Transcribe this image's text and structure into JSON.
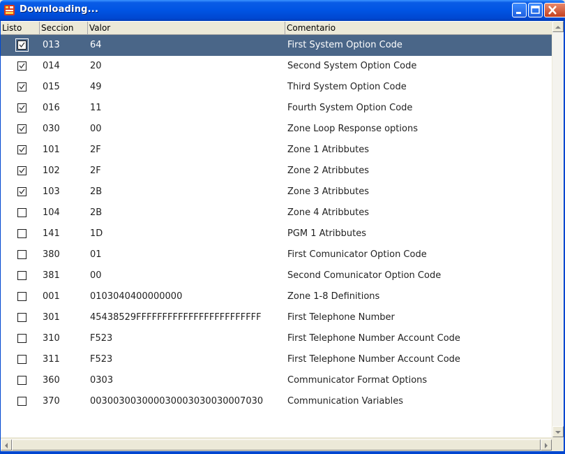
{
  "window": {
    "title": "Downloading...",
    "icon": "app-icon",
    "controls": [
      "minimize-icon",
      "maximize-icon",
      "close-icon"
    ]
  },
  "table": {
    "columns": [
      "Listo",
      "Seccion",
      "Valor",
      "Comentario"
    ],
    "rows": [
      {
        "checked": true,
        "seccion": "013",
        "valor": "64",
        "comentario": "First System Option Code",
        "selected": true
      },
      {
        "checked": true,
        "seccion": "014",
        "valor": "20",
        "comentario": "Second System Option Code"
      },
      {
        "checked": true,
        "seccion": "015",
        "valor": "49",
        "comentario": "Third System Option Code"
      },
      {
        "checked": true,
        "seccion": "016",
        "valor": "11",
        "comentario": "Fourth System Option Code"
      },
      {
        "checked": true,
        "seccion": "030",
        "valor": "00",
        "comentario": "Zone Loop Response options"
      },
      {
        "checked": true,
        "seccion": "101",
        "valor": "2F",
        "comentario": "Zone 1 Atribbutes"
      },
      {
        "checked": true,
        "seccion": "102",
        "valor": "2F",
        "comentario": "Zone 2 Atribbutes"
      },
      {
        "checked": true,
        "seccion": "103",
        "valor": "2B",
        "comentario": "Zone 3 Atribbutes"
      },
      {
        "checked": false,
        "seccion": "104",
        "valor": "2B",
        "comentario": "Zone 4 Atribbutes"
      },
      {
        "checked": false,
        "seccion": "141",
        "valor": "1D",
        "comentario": "PGM 1 Atribbutes"
      },
      {
        "checked": false,
        "seccion": "380",
        "valor": "01",
        "comentario": "First Comunicator Option Code"
      },
      {
        "checked": false,
        "seccion": "381",
        "valor": "00",
        "comentario": "Second Comunicator Option Code"
      },
      {
        "checked": false,
        "seccion": "001",
        "valor": "0103040400000000",
        "comentario": "Zone 1-8 Definitions"
      },
      {
        "checked": false,
        "seccion": "301",
        "valor": "45438529FFFFFFFFFFFFFFFFFFFFFFFF",
        "comentario": "First Telephone Number"
      },
      {
        "checked": false,
        "seccion": "310",
        "valor": "F523",
        "comentario": "First Telephone Number Account Code"
      },
      {
        "checked": false,
        "seccion": "311",
        "valor": "F523",
        "comentario": "First Telephone Number Account Code"
      },
      {
        "checked": false,
        "seccion": "360",
        "valor": "0303",
        "comentario": "Communicator Format Options"
      },
      {
        "checked": false,
        "seccion": "370",
        "valor": "003003003000030003030030007030",
        "comentario": "Communication Variables"
      }
    ]
  },
  "colors": {
    "titlebar": "#0054e3",
    "selected_row": "#4a6688",
    "window_bg": "#ece9d8"
  }
}
